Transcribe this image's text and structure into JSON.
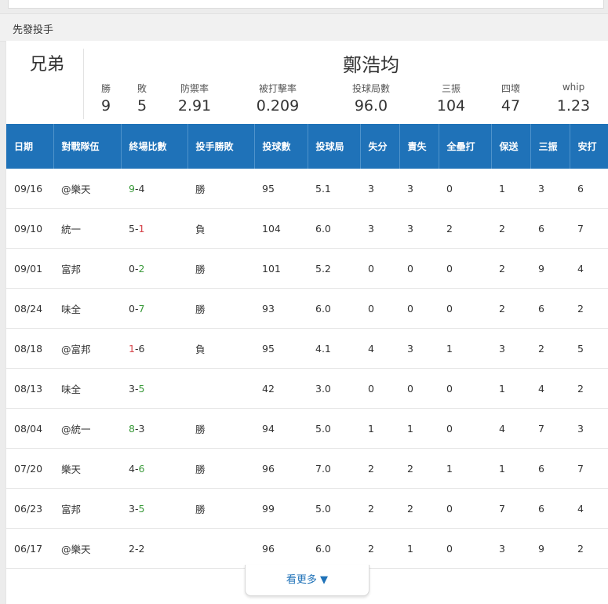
{
  "section": {
    "title": "先發投手"
  },
  "pitcher": {
    "team": "兄弟",
    "name": "鄭浩均",
    "stats": [
      {
        "label": "勝",
        "value": "9"
      },
      {
        "label": "敗",
        "value": "5"
      },
      {
        "label": "防禦率",
        "value": "2.91"
      },
      {
        "label": "被打擊率",
        "value": "0.209"
      },
      {
        "label": "投球局數",
        "value": "96.0"
      },
      {
        "label": "三振",
        "value": "104"
      },
      {
        "label": "四壞",
        "value": "47"
      },
      {
        "label": "whip",
        "value": "1.23"
      }
    ]
  },
  "table": {
    "headers": [
      "日期",
      "對戰隊伍",
      "終場比數",
      "投手勝敗",
      "投球數",
      "投球局",
      "失分",
      "責失",
      "全壘打",
      "保送",
      "三振",
      "安打"
    ],
    "rows": [
      {
        "date": "09/16",
        "opponent": "@樂天",
        "score_a": "9",
        "score_b": "4",
        "winner": "a",
        "result": "勝",
        "pitches": "95",
        "innings": "5.1",
        "runs": "3",
        "earned": "3",
        "hr": "0",
        "bb": "1",
        "so": "3",
        "hits": "6"
      },
      {
        "date": "09/10",
        "opponent": "統一",
        "score_a": "5",
        "score_b": "1",
        "winner": "b",
        "result": "負",
        "pitches": "104",
        "innings": "6.0",
        "runs": "3",
        "earned": "3",
        "hr": "2",
        "bb": "2",
        "so": "6",
        "hits": "7"
      },
      {
        "date": "09/01",
        "opponent": "富邦",
        "score_a": "0",
        "score_b": "2",
        "winner": "b_win",
        "result": "勝",
        "pitches": "101",
        "innings": "5.2",
        "runs": "0",
        "earned": "0",
        "hr": "0",
        "bb": "2",
        "so": "9",
        "hits": "4"
      },
      {
        "date": "08/24",
        "opponent": "味全",
        "score_a": "0",
        "score_b": "7",
        "winner": "b_win",
        "result": "勝",
        "pitches": "93",
        "innings": "6.0",
        "runs": "0",
        "earned": "0",
        "hr": "0",
        "bb": "2",
        "so": "6",
        "hits": "2"
      },
      {
        "date": "08/18",
        "opponent": "@富邦",
        "score_a": "1",
        "score_b": "6",
        "winner": "a_loss",
        "result": "負",
        "pitches": "95",
        "innings": "4.1",
        "runs": "4",
        "earned": "3",
        "hr": "1",
        "bb": "3",
        "so": "2",
        "hits": "5"
      },
      {
        "date": "08/13",
        "opponent": "味全",
        "score_a": "3",
        "score_b": "5",
        "winner": "b_win",
        "result": "",
        "pitches": "42",
        "innings": "3.0",
        "runs": "0",
        "earned": "0",
        "hr": "0",
        "bb": "1",
        "so": "4",
        "hits": "2"
      },
      {
        "date": "08/04",
        "opponent": "@統一",
        "score_a": "8",
        "score_b": "3",
        "winner": "a",
        "result": "勝",
        "pitches": "94",
        "innings": "5.0",
        "runs": "1",
        "earned": "1",
        "hr": "0",
        "bb": "4",
        "so": "7",
        "hits": "3"
      },
      {
        "date": "07/20",
        "opponent": "樂天",
        "score_a": "4",
        "score_b": "6",
        "winner": "b_win",
        "result": "勝",
        "pitches": "96",
        "innings": "7.0",
        "runs": "2",
        "earned": "2",
        "hr": "1",
        "bb": "1",
        "so": "6",
        "hits": "7"
      },
      {
        "date": "06/23",
        "opponent": "富邦",
        "score_a": "3",
        "score_b": "5",
        "winner": "b_win",
        "result": "勝",
        "pitches": "99",
        "innings": "5.0",
        "runs": "2",
        "earned": "2",
        "hr": "0",
        "bb": "7",
        "so": "6",
        "hits": "4"
      },
      {
        "date": "06/17",
        "opponent": "@樂天",
        "score_a": "2",
        "score_b": "2",
        "winner": "none",
        "result": "",
        "pitches": "96",
        "innings": "6.0",
        "runs": "2",
        "earned": "1",
        "hr": "0",
        "bb": "3",
        "so": "9",
        "hits": "2"
      }
    ]
  },
  "more_button": {
    "label": "看更多 ▼"
  },
  "colors": {
    "header_bg": "#1f72b8",
    "win": "#3a9a3a",
    "loss": "#d6444a",
    "link": "#1f72b8"
  }
}
